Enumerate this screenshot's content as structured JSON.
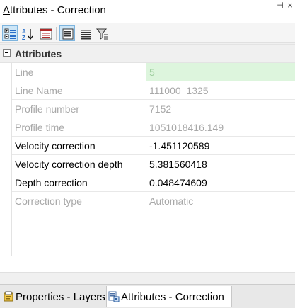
{
  "window": {
    "title_prefix": "A",
    "title_rest": "ttributes - Correction",
    "pin_glyph": "⊣",
    "close_glyph": "×"
  },
  "toolbar": {
    "buttons": [
      {
        "name": "categorized-icon",
        "active": true
      },
      {
        "name": "alphabetical-sort-icon",
        "active": false
      },
      {
        "name": "property-pages-icon",
        "active": false
      },
      {
        "name": "show-description-icon",
        "active": true
      },
      {
        "name": "show-all-icon",
        "active": false
      },
      {
        "name": "filter-icon",
        "active": false
      }
    ]
  },
  "grid": {
    "category": "Attributes",
    "rows": [
      {
        "name": "Line",
        "value": "5",
        "readonly": true,
        "selected": true
      },
      {
        "name": "Line Name",
        "value": "111000_1325",
        "readonly": true,
        "selected": false
      },
      {
        "name": "Profile number",
        "value": "7152",
        "readonly": true,
        "selected": false
      },
      {
        "name": "Profile time",
        "value": "1051018416.149",
        "readonly": true,
        "selected": false
      },
      {
        "name": "Velocity correction",
        "value": "-1.451120589",
        "readonly": false,
        "selected": false
      },
      {
        "name": "Velocity correction depth",
        "value": "5.381560418",
        "readonly": false,
        "selected": false
      },
      {
        "name": "Depth correction",
        "value": "0.048474609",
        "readonly": false,
        "selected": false
      },
      {
        "name": "Correction type",
        "value": "Automatic",
        "readonly": true,
        "selected": false
      }
    ]
  },
  "tabs": [
    {
      "label": "Properties - Layers",
      "icon": "properties-icon",
      "active": false
    },
    {
      "label": "Attributes - Correction",
      "icon": "attributes-icon",
      "active": true
    }
  ]
}
